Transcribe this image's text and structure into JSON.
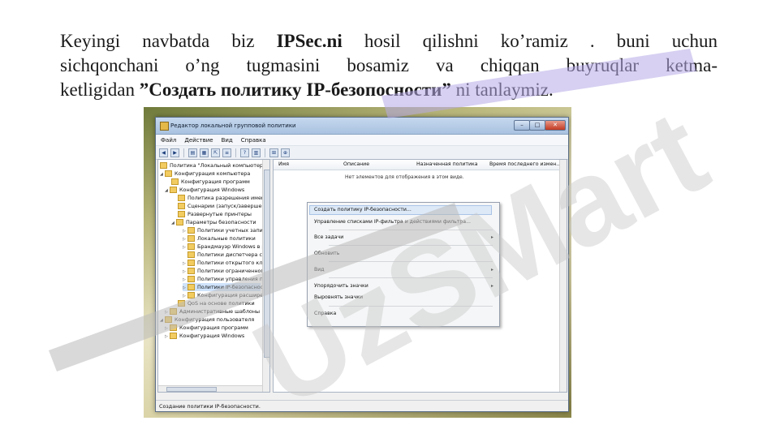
{
  "paragraph": {
    "line1_a": "Keyingi navbatda biz ",
    "line1_b": "IPSec.ni",
    "line1_c": " hosil qilishni ko’ramiz . buni uchun",
    "line2": "sichqonchani o’ng tugmasini bosamiz va chiqqan buyruqlar ketma-",
    "line3_a": "ketligidan ",
    "line3_b": "”Создать политику  IP-безопосности”",
    "line3_c": " ni tanlaymiz."
  },
  "window": {
    "title": "Редактор локальной групповой политики",
    "btn_min": "–",
    "btn_max": "□",
    "btn_close": "✕"
  },
  "menubar": [
    "Файл",
    "Действие",
    "Вид",
    "Справка"
  ],
  "toolbar_icons": [
    "back-icon",
    "forward-icon",
    "folder-icon",
    "view-icon",
    "export-icon",
    "properties-icon",
    "help-icon",
    "list-icon",
    "filter-icon",
    "snapin-icon"
  ],
  "tree": [
    "Политика \"Локальный компьютер\"",
    "Конфигурация компьютера",
    "Конфигурация программ",
    "Конфигурация Windows",
    "Политика разрешения имен",
    "Сценарии (запуск/завершение)",
    "Развернутые принтеры",
    "Параметры безопасности",
    "Политики учетных записей",
    "Локальные политики",
    "Брандмауэр Windows в режиме",
    "Политики диспетчера списков",
    "Политики открытого ключа",
    "Политики ограниченного",
    "Политики управления приложениями",
    "Политики IP-безопасности",
    "Конфигурация расширенной",
    "QoS на основе политики",
    "Административные шаблоны",
    "Конфигурация пользователя",
    "Конфигурация программ",
    "Конфигурация Windows"
  ],
  "columns": [
    "Имя",
    "Описание",
    "Назначенная политика",
    "Время последнего измен..."
  ],
  "empty_text": "Нет элементов для отображения в этом виде.",
  "context_menu": {
    "item1": "Создать политику IP-безопасности...",
    "item2": "Управление списками IP-фильтра и действиями фильтра...",
    "item3": "Все задачи",
    "item4": "Обновить",
    "item5": "Вид",
    "item6": "Упорядочить значки",
    "item7": "Выровнять значки",
    "item8": "Справка",
    "arrow": "▸"
  },
  "status_text": "Создание политики IP-безопасности.",
  "watermark": "UzSMart",
  "colors": {
    "watermark_gray": "#c8c8c8",
    "watermark_purple": "#b7a9e8",
    "selection": "#cfe3fb"
  }
}
